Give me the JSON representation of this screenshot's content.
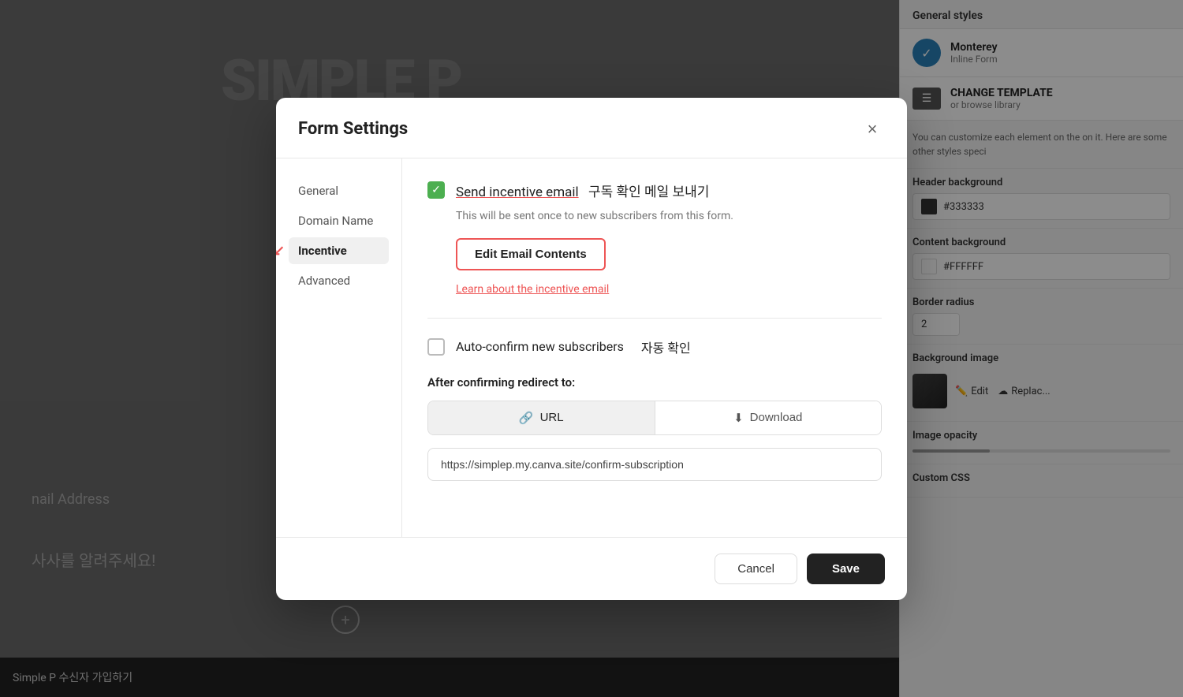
{
  "background": {
    "logo_text": "SIMPLE P",
    "email_label": "nail Address",
    "korean_text": "사사를 알려주세요!",
    "bottom_bar_text": "Simple P  수신자 가입하기"
  },
  "right_panel": {
    "section_title": "General styles",
    "template": {
      "name": "Monterey",
      "sub": "Inline Form",
      "icon": "✓"
    },
    "change_template": {
      "main": "CHANGE TEMPLATE",
      "sub": "or browse library"
    },
    "description": "You can customize each element on the on it. Here are some other styles speci",
    "header_background": {
      "label": "Header background",
      "color": "#333333"
    },
    "content_background": {
      "label": "Content background",
      "color": "#FFFFFF"
    },
    "border_radius": {
      "label": "Border radius",
      "value": "2"
    },
    "background_image": {
      "label": "Background image",
      "edit": "Edit",
      "replace": "Replac..."
    },
    "image_opacity": {
      "label": "Image opacity"
    },
    "custom_css": {
      "label": "Custom CSS"
    }
  },
  "modal": {
    "title": "Form Settings",
    "close_label": "×",
    "nav": {
      "general": "General",
      "domain_name": "Domain Name",
      "incentive": "Incentive",
      "advanced": "Advanced"
    },
    "active_tab": "Incentive",
    "incentive": {
      "send_incentive_label": "Send incentive email",
      "send_incentive_korean": "구독 확인 메일 보내기",
      "send_incentive_desc": "This will be sent once to new subscribers from this form.",
      "edit_email_btn": "Edit Email Contents",
      "learn_link": "Learn about the incentive email",
      "auto_confirm_label": "Auto-confirm new subscribers",
      "auto_confirm_korean": "자동 확인",
      "redirect_label": "After confirming redirect to:",
      "url_option": "URL",
      "download_option": "Download",
      "url_value": "https://simplep.my.canva.site/confirm-subscription"
    },
    "footer": {
      "cancel": "Cancel",
      "save": "Save"
    }
  }
}
